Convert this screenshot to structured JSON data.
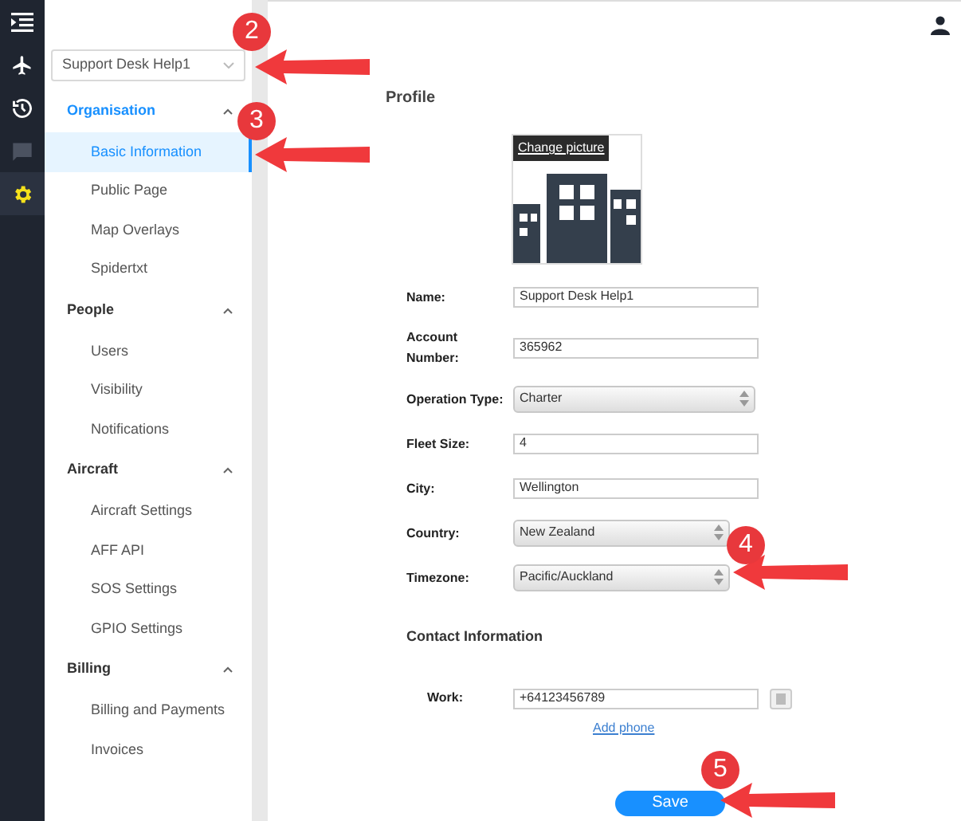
{
  "rail": [
    {
      "kind": "menu",
      "selected": false
    },
    {
      "kind": "plane",
      "selected": false
    },
    {
      "kind": "history",
      "selected": false
    },
    {
      "kind": "chat",
      "selected": false
    },
    {
      "kind": "gear",
      "selected": true
    }
  ],
  "account_select": {
    "value": "Support Desk Help1"
  },
  "sidebar": {
    "sections": [
      {
        "label": "Organisation",
        "selected": true,
        "expanded": true,
        "items": [
          {
            "label": "Basic Information",
            "selected": true
          },
          {
            "label": "Public Page",
            "selected": false
          },
          {
            "label": "Map Overlays",
            "selected": false
          },
          {
            "label": "Spidertxt",
            "selected": false
          }
        ]
      },
      {
        "label": "People",
        "selected": false,
        "expanded": true,
        "items": [
          {
            "label": "Users",
            "selected": false
          },
          {
            "label": "Visibility",
            "selected": false
          },
          {
            "label": "Notifications",
            "selected": false
          }
        ]
      },
      {
        "label": "Aircraft",
        "selected": false,
        "expanded": true,
        "items": [
          {
            "label": "Aircraft Settings",
            "selected": false
          },
          {
            "label": "AFF API",
            "selected": false
          },
          {
            "label": "SOS Settings",
            "selected": false
          },
          {
            "label": "GPIO Settings",
            "selected": false
          }
        ]
      },
      {
        "label": "Billing",
        "selected": false,
        "expanded": true,
        "items": [
          {
            "label": "Billing and Payments",
            "selected": false
          },
          {
            "label": "Invoices",
            "selected": false
          }
        ]
      }
    ]
  },
  "profile": {
    "title": "Profile",
    "change_picture": "Change picture",
    "fields": [
      {
        "kind": "text",
        "label": "Name:",
        "value": "Support Desk Help1"
      },
      {
        "kind": "text",
        "label": "Account Number:",
        "value": "365962"
      },
      {
        "kind": "select",
        "label": "Operation Type:",
        "value": "Charter"
      },
      {
        "kind": "text",
        "label": "Fleet Size:",
        "value": "4"
      },
      {
        "kind": "text",
        "label": "City:",
        "value": "Wellington"
      },
      {
        "kind": "select",
        "label": "Country:",
        "value": "New Zealand"
      },
      {
        "kind": "select",
        "label": "Timezone:",
        "value": "Pacific/Auckland"
      }
    ],
    "contact_title": "Contact Information",
    "phones": [
      {
        "label": "Work:",
        "value": "+64123456789"
      }
    ],
    "add_phone": "Add phone",
    "save": "Save"
  },
  "callouts": [
    {
      "number": "2"
    },
    {
      "number": "3"
    },
    {
      "number": "4"
    },
    {
      "number": "5"
    }
  ]
}
